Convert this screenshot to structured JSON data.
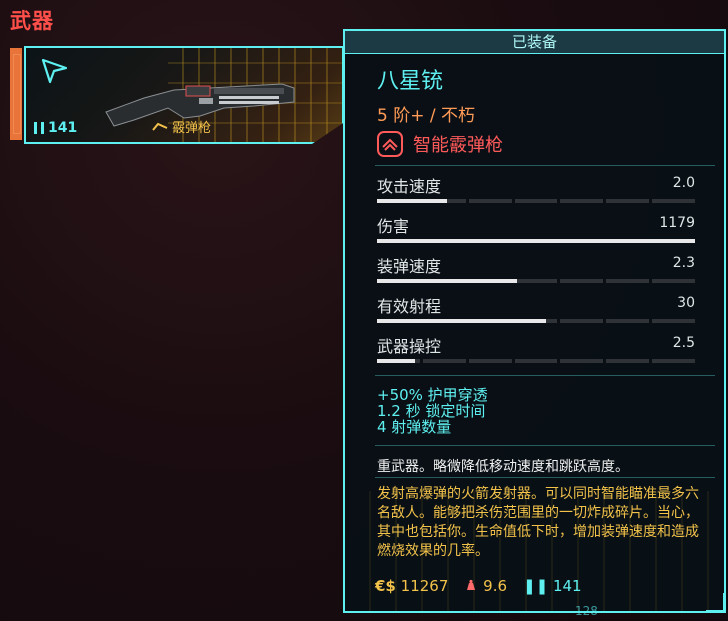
{
  "section": {
    "title": "武器"
  },
  "weapon_card": {
    "ammo": "141",
    "type_label": "霰弹枪"
  },
  "tooltip": {
    "header": "已装备",
    "item_name": "八星铳",
    "tier": "5 阶+ / 不朽",
    "tech_label": "智能霰弹枪",
    "stats": [
      {
        "name": "攻击速度",
        "value": "2.0",
        "fill": 0.22
      },
      {
        "name": "伤害",
        "value": "1179",
        "fill": 1.0
      },
      {
        "name": "装弹速度",
        "value": "2.3",
        "fill": 0.44
      },
      {
        "name": "有效射程",
        "value": "30",
        "fill": 0.53
      },
      {
        "name": "武器操控",
        "value": "2.5",
        "fill": 0.12
      }
    ],
    "mods": [
      "+50% 护甲穿透",
      "1.2 秒 锁定时间",
      "4 射弹数量"
    ],
    "description_short": "重武器。略微降低移动速度和跳跃高度。",
    "description_long": "发射高爆弹的火箭发射器。可以同时智能瞄准最多六名敌人。能够把杀伤范围里的一切炸成碎片。当心，其中也包括你。生命值低下时，增加装弹速度和造成燃烧效果的几率。",
    "footer": {
      "price_icon": "€$",
      "price": "11267",
      "weight": "9.6",
      "ammo": "141"
    }
  },
  "peek": {
    "value": "128"
  },
  "colors": {
    "accent_cyan": "#5ef0f0",
    "accent_red": "#ff4f4a",
    "accent_yellow": "#f2c24a",
    "accent_orange": "#ff9b56"
  }
}
